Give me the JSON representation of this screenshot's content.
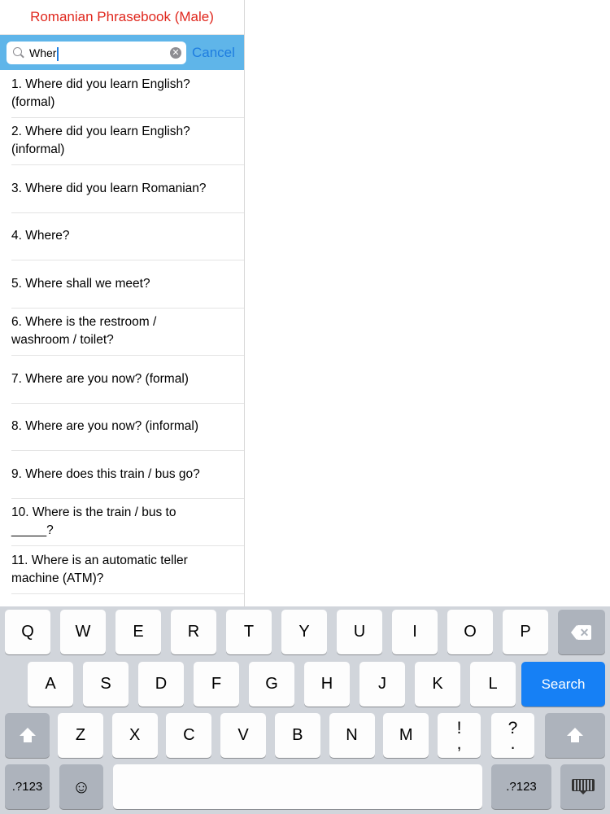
{
  "app": {
    "title": "Romanian Phrasebook (Male)"
  },
  "search": {
    "value": "Wher",
    "cancel_label": "Cancel",
    "icon": "search-icon",
    "clear_icon": "clear-icon"
  },
  "results": [
    "1. Where did you learn English? (formal)",
    "2. Where did you learn English? (informal)",
    "3. Where did you learn Romanian?",
    "4. Where?",
    "5. Where shall we meet?",
    "6. Where is the restroom / washroom / toilet?",
    "7. Where are you now? (formal)",
    "8. Where are you now? (informal)",
    "9. Where does this train / bus go?",
    "10. Where is the train / bus to _____?",
    "11. Where is an automatic teller machine (ATM)?"
  ],
  "keyboard": {
    "row1": [
      "Q",
      "W",
      "E",
      "R",
      "T",
      "Y",
      "U",
      "I",
      "O",
      "P"
    ],
    "row2": [
      "A",
      "S",
      "D",
      "F",
      "G",
      "H",
      "J",
      "K",
      "L"
    ],
    "row3": [
      "Z",
      "X",
      "C",
      "V",
      "B",
      "N",
      "M"
    ],
    "punct1": [
      "!",
      ","
    ],
    "punct2": [
      "?",
      "."
    ],
    "search_label": "Search",
    "numbers_label": ".?123",
    "emoji": "☺",
    "icons": [
      "backspace-icon",
      "shift-icon",
      "emoji-icon",
      "keyboard-hide-icon"
    ],
    "colors": {
      "accent": "#1680f5",
      "title_red": "#e0281e",
      "search_bar": "#5fb5e9"
    }
  }
}
